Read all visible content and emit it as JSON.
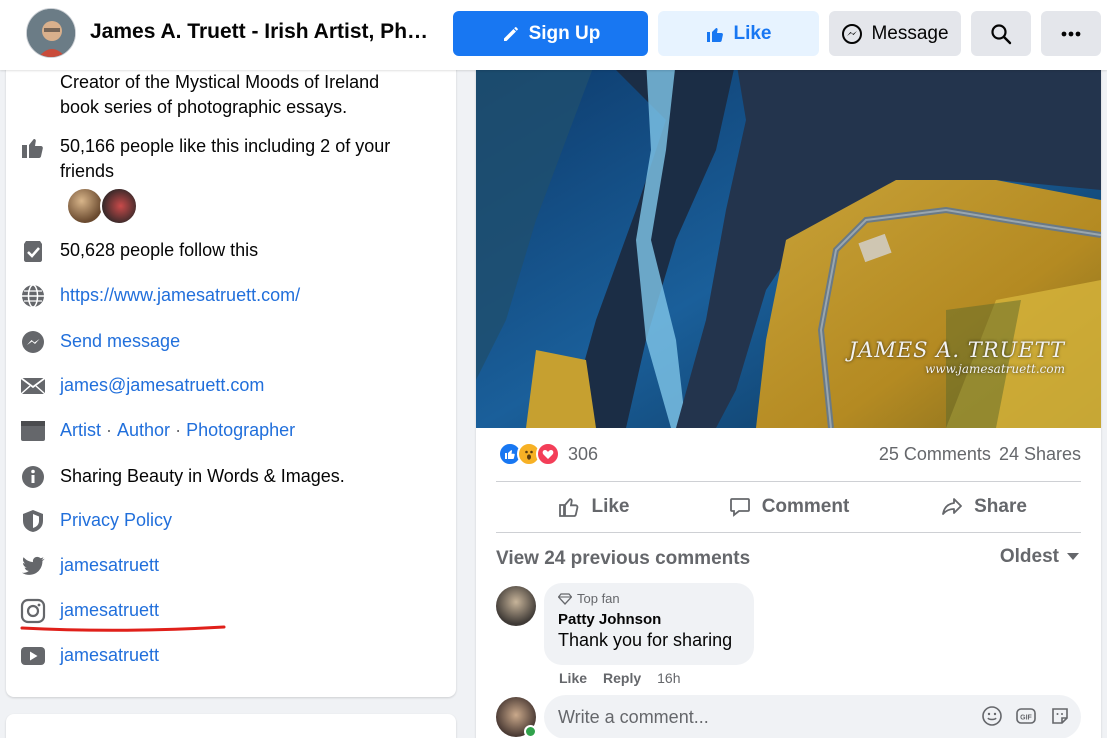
{
  "header": {
    "page_name": "James A. Truett - Irish Artist, Photographer & Author",
    "signup_label": "Sign Up",
    "like_label": "Like",
    "message_label": "Message"
  },
  "intro": {
    "description": "Creator of the Mystical Moods of Ireland book series of photographic essays.",
    "likes_text": "50,166 people like this including 2 of your friends",
    "follows_text": "50,628 people follow this",
    "website": "https://www.jamesatruett.com/",
    "send_message": "Send message",
    "email": "james@jamesatruett.com",
    "categories": [
      "Artist",
      "Author",
      "Photographer"
    ],
    "tagline": "Sharing Beauty in Words & Images.",
    "privacy": "Privacy Policy",
    "twitter": "jamesatruett",
    "instagram": "jamesatruett",
    "youtube": "jamesatruett"
  },
  "post": {
    "watermark_name": "JAMES A. TRUETT",
    "watermark_url": "www.jamesatruett.com",
    "reaction_count": "306",
    "comments_count": "25 Comments",
    "shares_count": "24 Shares",
    "like_action": "Like",
    "comment_action": "Comment",
    "share_action": "Share",
    "view_previous": "View 24 previous comments",
    "sort_label": "Oldest"
  },
  "comment": {
    "badge": "Top fan",
    "author": "Patty Johnson",
    "text": "Thank you for sharing",
    "like": "Like",
    "reply": "Reply",
    "time": "16h"
  },
  "composer": {
    "placeholder": "Write a comment..."
  },
  "colors": {
    "brand_blue": "#1877f2",
    "link_blue": "#216fdb",
    "underline_red": "#e0201a"
  },
  "icons": [
    "pencil-icon",
    "thumbs-up-icon",
    "messenger-icon",
    "search-icon",
    "more-icon",
    "follow-icon",
    "globe-icon",
    "mail-icon",
    "category-icon",
    "info-icon",
    "shield-icon",
    "twitter-icon",
    "instagram-icon",
    "youtube-icon",
    "share-icon",
    "comment-icon",
    "diamond-icon",
    "emoji-icon",
    "gif-icon",
    "sticker-icon"
  ]
}
